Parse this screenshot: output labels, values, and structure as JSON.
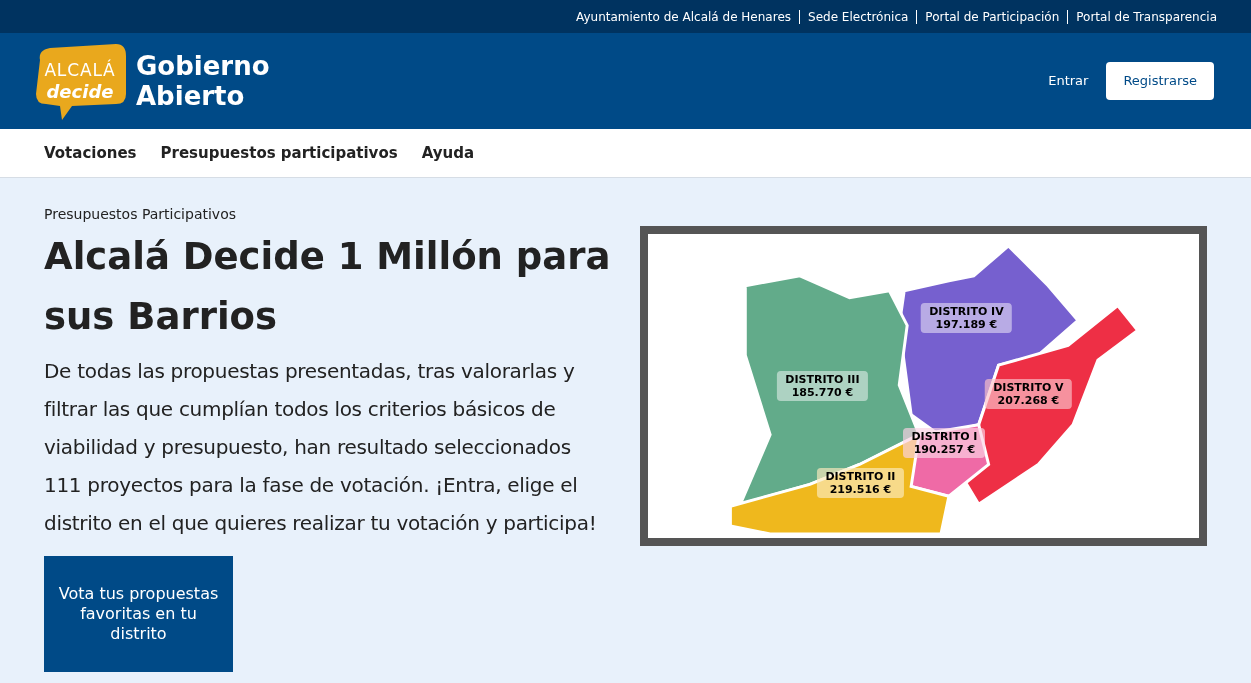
{
  "top_links": [
    "Ayuntamiento de Alcalá de Henares",
    "Sede Electrónica",
    "Portal de Participación",
    "Portal de Transparencia"
  ],
  "header": {
    "logo_top": "ALCALÁ",
    "logo_bottom": "decide",
    "title_line1": "Gobierno",
    "title_line2": "Abierto",
    "login": "Entrar",
    "register": "Registrarse"
  },
  "nav": [
    "Votaciones",
    "Presupuestos participativos",
    "Ayuda"
  ],
  "hero": {
    "breadcrumb": "Presupuestos Participativos",
    "title": "Alcalá Decide 1 Millón para sus Barrios",
    "text": "De todas las propuestas presentadas, tras valorarlas y filtrar las que cumplían todos los criterios básicos de viabilidad y presupuesto, han resultado seleccionados 111 proyectos para la fase de votación. ¡Entra, elige el distrito en el que quieres realizar tu votación y participa!",
    "button": "Vota tus propuestas favoritas en tu distrito"
  },
  "map": {
    "districts": [
      {
        "name": "DISTRITO IV",
        "amount": "197.189 €",
        "color": "#7660cf"
      },
      {
        "name": "DISTRITO III",
        "amount": "185.770 €",
        "color": "#62ab8a"
      },
      {
        "name": "DISTRITO V",
        "amount": "207.268 €",
        "color": "#ee2f45"
      },
      {
        "name": "DISTRITO I",
        "amount": "190.257 €",
        "color": "#ef6aa6"
      },
      {
        "name": "DISTRITO II",
        "amount": "219.516 €",
        "color": "#efb81d"
      }
    ]
  }
}
